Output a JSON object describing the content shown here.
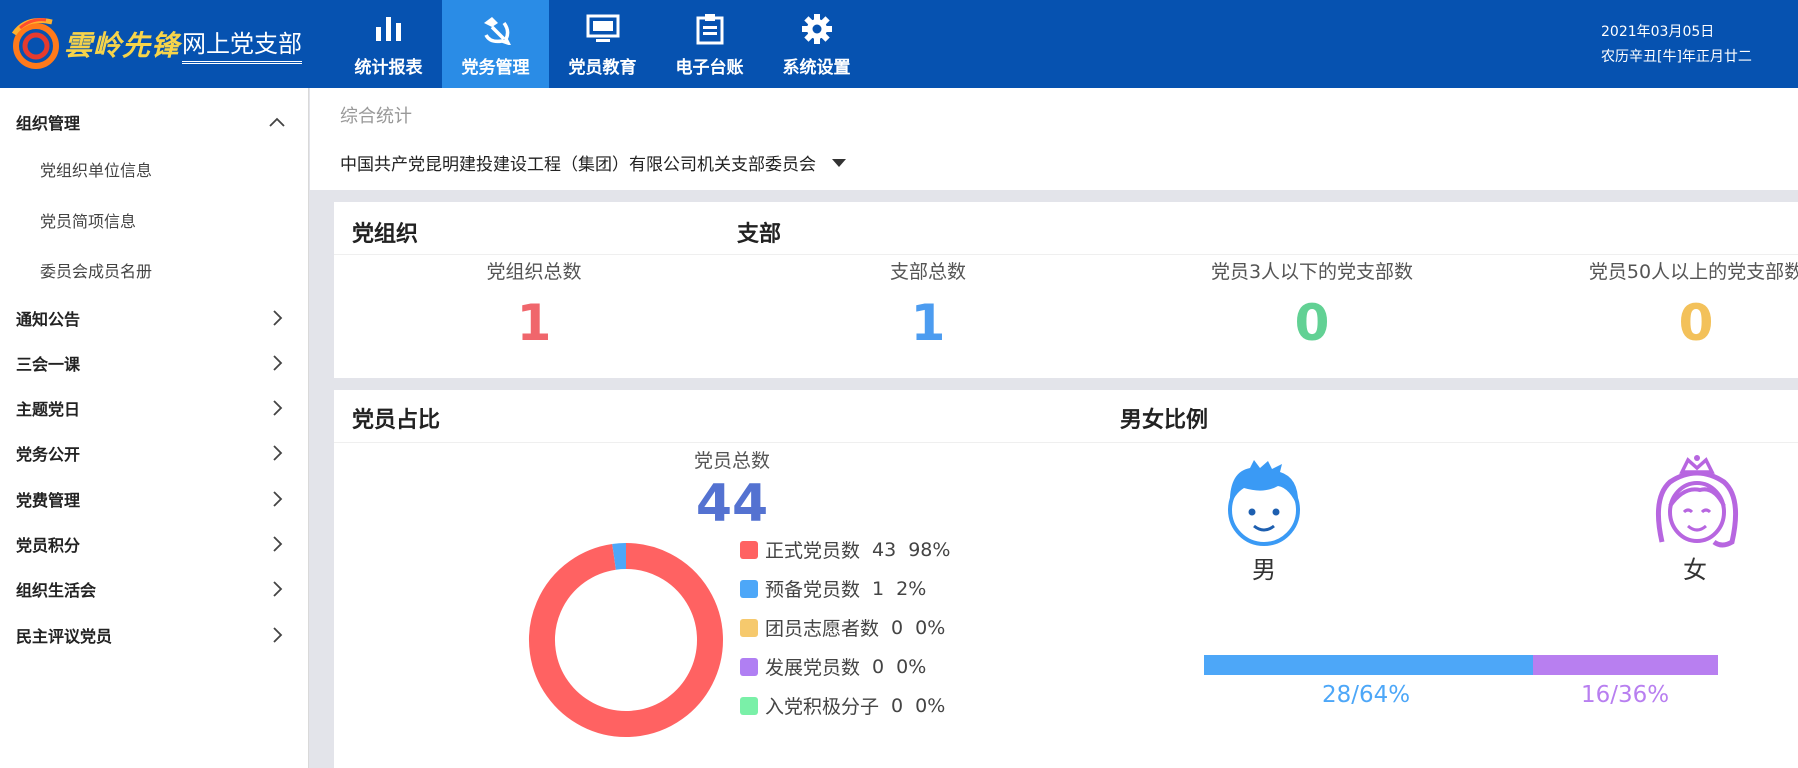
{
  "app": {
    "logo_script": "雲岭先锋",
    "logo_name": "网上党支部",
    "date": "2021年03月05日",
    "lunar": "农历辛丑[牛]年正月廿二"
  },
  "nav": [
    {
      "label": "统计报表",
      "icon": "bar-chart-icon"
    },
    {
      "label": "党务管理",
      "icon": "party-emblem-icon",
      "active": true
    },
    {
      "label": "党员教育",
      "icon": "monitor-icon"
    },
    {
      "label": "电子台账",
      "icon": "clipboard-icon"
    },
    {
      "label": "系统设置",
      "icon": "gear-icon"
    }
  ],
  "sidebar": {
    "group_title": "组织管理",
    "sub_items": [
      "党组织单位信息",
      "党员简项信息",
      "委员会成员名册"
    ],
    "menus": [
      "通知公告",
      "三会一课",
      "主题党日",
      "党务公开",
      "党费管理",
      "党员积分",
      "组织生活会",
      "民主评议党员"
    ]
  },
  "main": {
    "breadcrumb": "综合统计",
    "org_selected": "中国共产党昆明建投建设工程（集团）有限公司机关支部委员会"
  },
  "org_card": {
    "title_left": "党组织",
    "title_right": "支部",
    "stats": [
      {
        "label": "党组织总数",
        "value": "1",
        "color": "#f0666c"
      },
      {
        "label": "支部总数",
        "value": "1",
        "color": "#4c9cf0"
      },
      {
        "label": "党员3人以下的党支部数",
        "value": "0",
        "color": "#62d194"
      },
      {
        "label": "党员50人以上的党支部数",
        "value": "0",
        "color": "#f3c15a"
      }
    ]
  },
  "member_card": {
    "title": "党员占比",
    "total_label": "党员总数",
    "total_value": "44",
    "legend": [
      {
        "label": "正式党员数",
        "count": "43",
        "pct": "98%",
        "value": 43,
        "color": "#ff6262"
      },
      {
        "label": "预备党员数",
        "count": "1",
        "pct": "2%",
        "value": 1,
        "color": "#4da7f8"
      },
      {
        "label": "团员志愿者数",
        "count": "0",
        "pct": "0%",
        "value": 0,
        "color": "#f6c96d"
      },
      {
        "label": "发展党员数",
        "count": "0",
        "pct": "0%",
        "value": 0,
        "color": "#b07ff3"
      },
      {
        "label": "入党积极分子",
        "count": "0",
        "pct": "0%",
        "value": 0,
        "color": "#7af0a8"
      }
    ]
  },
  "gender_card": {
    "title": "男女比例",
    "male_label": "男",
    "female_label": "女",
    "male_text": "28/64%",
    "female_text": "16/36%",
    "male_fraction": 0.64,
    "male_color": "#4da7f8",
    "female_color": "#b87ff0"
  }
}
